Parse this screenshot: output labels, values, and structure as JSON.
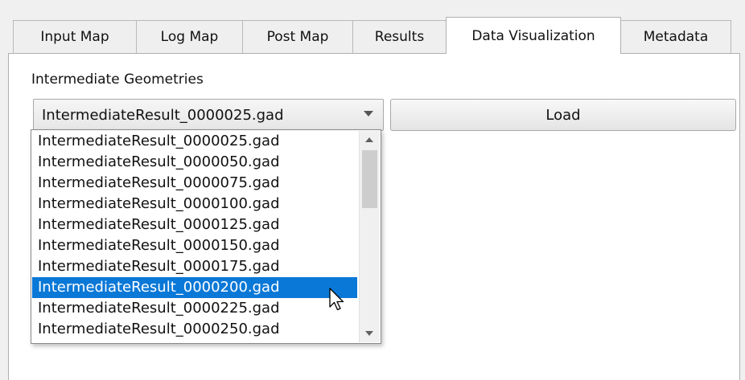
{
  "tabs": [
    {
      "label": "Input Map",
      "active": false
    },
    {
      "label": "Log Map",
      "active": false
    },
    {
      "label": "Post Map",
      "active": false
    },
    {
      "label": "Results",
      "active": false
    },
    {
      "label": "Data Visualization",
      "active": true
    },
    {
      "label": "Metadata",
      "active": false
    }
  ],
  "panel": {
    "section_label": "Intermediate Geometries",
    "combo": {
      "value": "IntermediateResult_0000025.gad",
      "options": [
        "IntermediateResult_0000025.gad",
        "IntermediateResult_0000050.gad",
        "IntermediateResult_0000075.gad",
        "IntermediateResult_0000100.gad",
        "IntermediateResult_0000125.gad",
        "IntermediateResult_0000150.gad",
        "IntermediateResult_0000175.gad",
        "IntermediateResult_0000200.gad",
        "IntermediateResult_0000225.gad",
        "IntermediateResult_0000250.gad"
      ],
      "highlighted_option": "IntermediateResult_0000200.gad"
    },
    "load_button_label": "Load"
  },
  "colors": {
    "selection": "#0a78d7",
    "panel_bg": "#ffffff",
    "window_bg": "#f0f0f0"
  },
  "icons": {
    "combo_arrow": "chevron-down-icon",
    "scroll_up": "arrow-up-icon",
    "scroll_down": "arrow-down-icon",
    "pointer": "mouse-pointer-icon"
  }
}
